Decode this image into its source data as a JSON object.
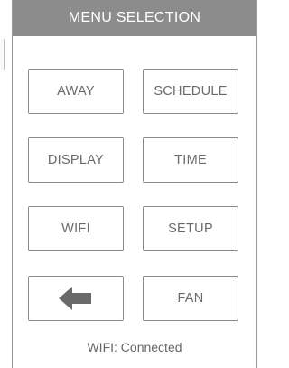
{
  "header": {
    "title": "MENU SELECTION"
  },
  "menu": {
    "away": "AWAY",
    "schedule": "SCHEDULE",
    "display": "DISPLAY",
    "time": "TIME",
    "wifi": "WIFI",
    "setup": "SETUP",
    "back_icon": "left-arrow-icon",
    "fan": "FAN"
  },
  "status": {
    "text": "WIFI: Connected"
  },
  "colors": {
    "header_bg": "#8c8c8c",
    "header_text": "#ffffff",
    "button_border": "#8a8a8a",
    "button_text": "#6a6a6a",
    "icon": "#6a6a6a"
  }
}
